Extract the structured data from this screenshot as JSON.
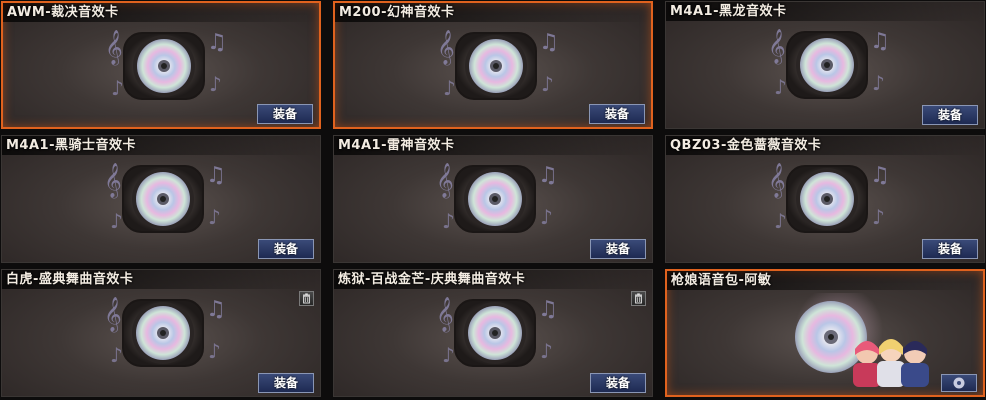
{
  "cards": [
    {
      "title": "AWM-裁决音效卡",
      "button": "装备",
      "selected": true,
      "deletable": false
    },
    {
      "title": "M200-幻神音效卡",
      "button": "装备",
      "selected": true,
      "deletable": false
    },
    {
      "title": "M4A1-黑龙音效卡",
      "button": "装备",
      "selected": false,
      "deletable": false
    },
    {
      "title": "M4A1-黑骑士音效卡",
      "button": "装备",
      "selected": false,
      "deletable": false
    },
    {
      "title": "M4A1-雷神音效卡",
      "button": "装备",
      "selected": false,
      "deletable": false
    },
    {
      "title": "QBZ03-金色蔷薇音效卡",
      "button": "装备",
      "selected": false,
      "deletable": false
    },
    {
      "title": "白虎-盛典舞曲音效卡",
      "button": "装备",
      "selected": false,
      "deletable": true
    },
    {
      "title": "炼狱-百战金芒-庆典舞曲音效卡",
      "button": "装备",
      "selected": false,
      "deletable": true
    },
    {
      "title": "枪娘语音包-阿敏",
      "button": "",
      "selected": true,
      "deletable": false,
      "type": "voice-pack"
    }
  ],
  "colors": {
    "selected_border": "#e0621e",
    "button_bg": "#2a3866",
    "title_text": "#f3ece2"
  },
  "icons": {
    "card_art": "music-disc-icon",
    "delete": "trash-icon",
    "voice_pack_button": "disc-play-icon"
  }
}
